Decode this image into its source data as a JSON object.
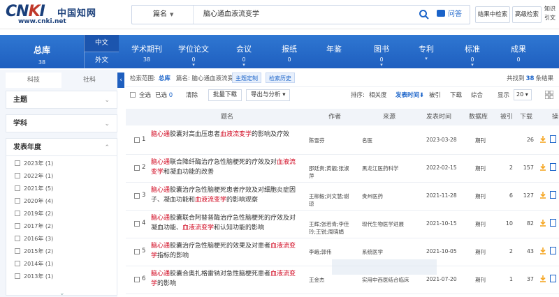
{
  "header": {
    "logo_latin": "CNKI",
    "logo_cn": "中国知网",
    "logo_url": "www.cnki.net",
    "search_field": "篇名",
    "search_query": "脑心通血液流变学",
    "qa_label": "问答",
    "btn_search_in_results": "结果中检索",
    "btn_advanced": "高级检索",
    "right_text_line1": "知识",
    "right_text_line2": "引文"
  },
  "nav": {
    "zongku": {
      "label": "总库",
      "count": "38"
    },
    "lang_zh": "中文",
    "lang_en": "外文",
    "items": [
      {
        "label": "学术期刊",
        "count": "38",
        "caret": ""
      },
      {
        "label": "学位论文",
        "count": "0",
        "caret": "▾"
      },
      {
        "label": "会议",
        "count": "0",
        "caret": "▾"
      },
      {
        "label": "报纸",
        "count": "0",
        "caret": ""
      },
      {
        "label": "年鉴",
        "count": "",
        "caret": ""
      },
      {
        "label": "图书",
        "count": "0",
        "caret": "▾"
      },
      {
        "label": "专利",
        "count": "",
        "caret": "▾"
      },
      {
        "label": "标准",
        "count": "0",
        "caret": "▾"
      },
      {
        "label": "成果",
        "count": "0",
        "caret": ""
      }
    ]
  },
  "sidebar": {
    "tab_keji": "科技",
    "tab_sheke": "社科",
    "group_subject": "主题",
    "group_discipline": "学科",
    "group_year": "发表年度",
    "years": [
      {
        "year": "2023年",
        "count": "(1)"
      },
      {
        "year": "2022年",
        "count": "(1)"
      },
      {
        "year": "2021年",
        "count": "(5)"
      },
      {
        "year": "2020年",
        "count": "(4)"
      },
      {
        "year": "2019年",
        "count": "(2)"
      },
      {
        "year": "2017年",
        "count": "(2)"
      },
      {
        "year": "2016年",
        "count": "(3)"
      },
      {
        "year": "2015年",
        "count": "(2)"
      },
      {
        "year": "2014年",
        "count": "(1)"
      },
      {
        "year": "2013年",
        "count": "(1)"
      }
    ]
  },
  "results": {
    "scope_label": "检索范围:",
    "scope_value": "总库",
    "scope_field": "篇名: 脑心通血液流变学",
    "tag_custom": "主题定制",
    "tag_history": "检索历史",
    "total_prefix": "共找到",
    "total_count": "38",
    "total_suffix": "条结果",
    "select_all": "全选",
    "selected_label": "已选",
    "selected_count": "0",
    "clear": "清除",
    "batch_download": "批量下载",
    "export": "导出与分析 ▾",
    "sort_label": "排序:",
    "sort_relevance": "相关度",
    "sort_date": "发表时间⬇",
    "sort_cite": "被引",
    "sort_download": "下载",
    "sort_overall": "综合",
    "display_label": "显示",
    "page_size": "20 ▾",
    "columns": {
      "title": "题名",
      "author": "作者",
      "source": "来源",
      "date": "发表时间",
      "db": "数据库",
      "cite": "被引",
      "download": "下载",
      "op": "操"
    },
    "rows": [
      {
        "idx": "1",
        "title_parts": [
          [
            "脑心通",
            true
          ],
          [
            "胶囊对高血压患者",
            false
          ],
          [
            "血液流变学",
            true
          ],
          [
            "的影响及疗效",
            false
          ]
        ],
        "author": "陈雪芬",
        "source": "名医",
        "date": "2023-03-28",
        "db": "期刊",
        "cite": "",
        "download": "26"
      },
      {
        "idx": "2",
        "title_parts": [
          [
            "脑心通",
            true
          ],
          [
            "联合降纤酶治疗急性脑梗死的疗效及对",
            false
          ],
          [
            "血液流变学",
            true
          ],
          [
            "和凝血功能的改善",
            false
          ]
        ],
        "author": "邵廷贵;黄靓;张淑萍",
        "source": "黑龙江医药科学",
        "date": "2022-02-15",
        "db": "期刊",
        "cite": "2",
        "download": "157"
      },
      {
        "idx": "3",
        "title_parts": [
          [
            "脑心通",
            true
          ],
          [
            "胶囊治疗急性脑梗死患者疗效及对细胞炎症因子、凝血功能和",
            false
          ],
          [
            "血液流变学",
            true
          ],
          [
            "的影响观察",
            false
          ]
        ],
        "author": "王柳毅;刘文慧;谢琼",
        "source": "贵州医药",
        "date": "2021-11-28",
        "db": "期刊",
        "cite": "6",
        "download": "127"
      },
      {
        "idx": "4",
        "title_parts": [
          [
            "脑心通",
            true
          ],
          [
            "胶囊联合阿替普酶治疗急性脑梗死的疗效及对凝血功能、",
            false
          ],
          [
            "血液流变学",
            true
          ],
          [
            "和认知功能的影响",
            false
          ]
        ],
        "author": "王辉;张若青;李佳玲;王锐;周晓娟",
        "source": "现代生物医学进展",
        "date": "2021-10-15",
        "db": "期刊",
        "cite": "10",
        "download": "82"
      },
      {
        "idx": "5",
        "title_parts": [
          [
            "脑心通",
            true
          ],
          [
            "胶囊治疗急性脑梗死的效果及对患者",
            false
          ],
          [
            "血液流变学",
            true
          ],
          [
            "指标的影响",
            false
          ]
        ],
        "author": "李峨;郭伟",
        "source": "系统医学",
        "date": "2021-10-05",
        "db": "期刊",
        "cite": "2",
        "download": "43"
      },
      {
        "idx": "6",
        "title_parts": [
          [
            "脑心通",
            true
          ],
          [
            "胶囊合奥扎格雷钠对急性脑梗死患者",
            false
          ],
          [
            "血液流变学",
            true
          ],
          [
            "的影响",
            false
          ]
        ],
        "author": "王金杰",
        "source": "实用中西医结合临床",
        "date": "2021-07-20",
        "db": "期刊",
        "cite": "1",
        "download": "37"
      }
    ]
  },
  "colors": {
    "brand_blue": "#1f5fbf",
    "highlight_red": "#d0021b",
    "download_orange": "#f5a623"
  }
}
